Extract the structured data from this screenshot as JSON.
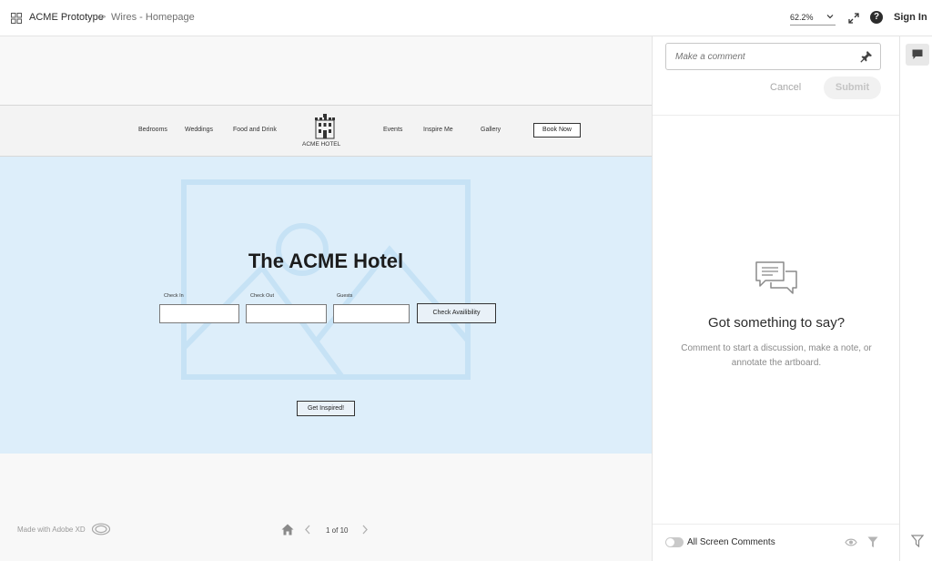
{
  "header": {
    "project": "ACME Prototype",
    "separator": ">",
    "page": "Wires - Homepage",
    "zoom": "62.2%",
    "sign_in": "Sign In"
  },
  "site": {
    "nav_left": [
      "Bedrooms",
      "Weddings",
      "Food and Drink"
    ],
    "logo_text": "ACME HOTEL",
    "nav_right": [
      "Events",
      "Inspire Me",
      "Gallery"
    ],
    "book_now": "Book Now",
    "hero_title": "The ACME Hotel",
    "fields": {
      "check_in": "Check In",
      "check_out": "Check Out",
      "guests": "Guests"
    },
    "check_button": "Check Availibility",
    "inspired_button": "Get Inspired!"
  },
  "footer": {
    "made_with": "Made with Adobe XD",
    "page_count": "1 of 10"
  },
  "comments": {
    "placeholder": "Make a comment",
    "cancel": "Cancel",
    "submit": "Submit",
    "empty_title": "Got something to say?",
    "empty_text": "Comment to start a discussion, make a note, or annotate the artboard.",
    "all_screen": "All Screen Comments"
  },
  "colors": {
    "hero_bg": "#ddeefa",
    "placeholder_stroke": "#c6e2f5"
  }
}
